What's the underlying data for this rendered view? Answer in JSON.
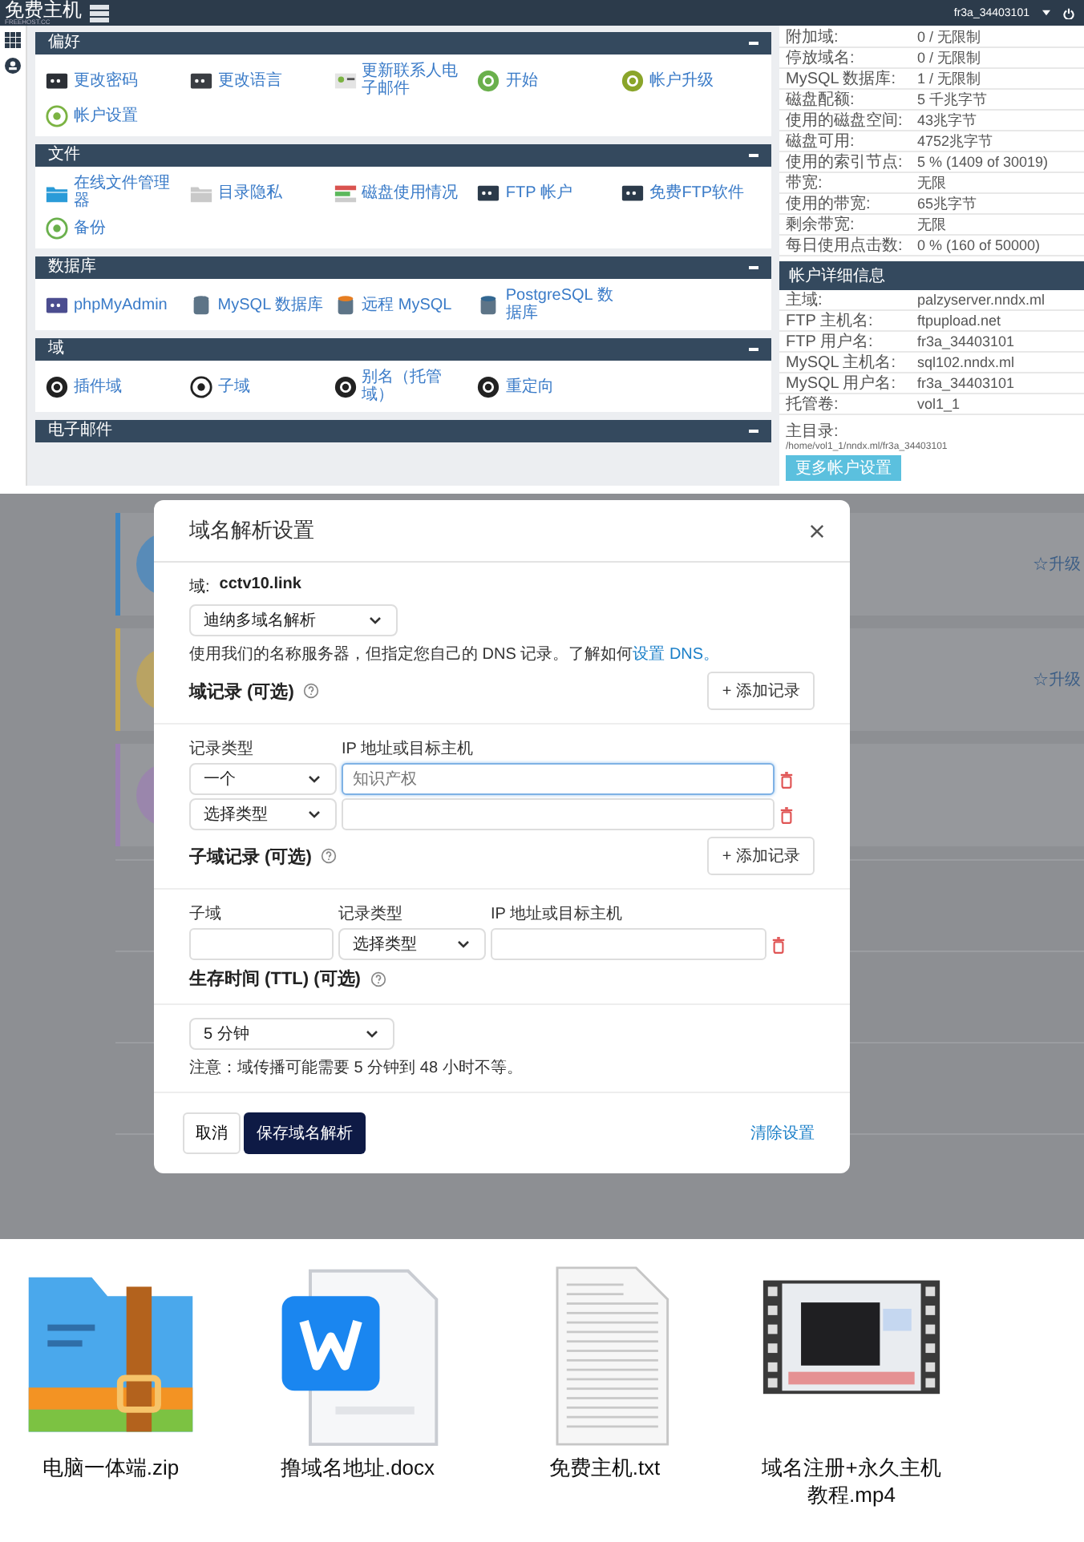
{
  "top_panel": {
    "header": {
      "logo": "免费主机",
      "logo_subtitle": "FREEHOST.CC",
      "user": "fr3a_34403101"
    },
    "sections": [
      {
        "title": "偏好",
        "items": [
          "更改密码",
          "更改语言",
          "更新联系人电子邮件",
          "开始",
          "帐户升级",
          "帐户设置"
        ]
      },
      {
        "title": "文件",
        "items": [
          "在线文件管理器",
          "目录隐私",
          "磁盘使用情况",
          "FTP 帐户",
          "免费FTP软件",
          "备份"
        ]
      },
      {
        "title": "数据库",
        "items": [
          "phpMyAdmin",
          "MySQL 数据库",
          "远程 MySQL",
          "PostgreSQL 数据库"
        ]
      },
      {
        "title": "域",
        "items": [
          "插件域",
          "子域",
          "别名（托管域）",
          "重定向"
        ]
      },
      {
        "title": "电子邮件"
      }
    ],
    "stats": [
      {
        "label": "附加域:",
        "value": "0 / 无限制"
      },
      {
        "label": "停放域名:",
        "value": "0 / 无限制"
      },
      {
        "label": "MySQL 数据库:",
        "value": "1 / 无限制"
      },
      {
        "label": "磁盘配额:",
        "value": "5 千兆字节"
      },
      {
        "label": "使用的磁盘空间:",
        "value": "43兆字节"
      },
      {
        "label": "磁盘可用:",
        "value": "4752兆字节"
      },
      {
        "label": "使用的索引节点:",
        "value": "5 % (1409 of 30019)"
      },
      {
        "label": "带宽:",
        "value": "无限"
      },
      {
        "label": "使用的带宽:",
        "value": "65兆字节"
      },
      {
        "label": "剩余带宽:",
        "value": "无限"
      },
      {
        "label": "每日使用点击数:",
        "value": "0 % (160 of 50000)"
      }
    ],
    "account_details": {
      "title": "帐户详细信息",
      "rows": [
        {
          "label": "主域:",
          "value": "palzyserver.nndx.ml"
        },
        {
          "label": "FTP 主机名:",
          "value": "ftpupload.net"
        },
        {
          "label": "FTP 用户名:",
          "value": "fr3a_34403101"
        },
        {
          "label": "MySQL 主机名:",
          "value": "sql102.nndx.ml"
        },
        {
          "label": "MySQL 用户名:",
          "value": "fr3a_34403101"
        },
        {
          "label": "托管卷:",
          "value": "vol1_1"
        }
      ],
      "home_label": "主目录:",
      "home_path": "/home/vol1_1/nndx.ml/fr3a_34403101",
      "button": "更多帐户设置"
    }
  },
  "dialog_panel": {
    "background": {
      "cards": [
        {
          "color": "#3d86c4",
          "link": "☆升级"
        },
        {
          "color": "#c8a84c",
          "link": "☆升级"
        },
        {
          "color": "#9b7fb3"
        }
      ]
    },
    "dialog": {
      "title": "域名解析设置",
      "domain_label": "域:",
      "domain": "cctv10.link",
      "mode_select": "迪纳多域名解析",
      "description": "使用我们的名称服务器，但指定您自己的 DNS 记录。了解如何",
      "description_link": "设置 DNS。",
      "domain_records": {
        "title": "域记录 (可选)",
        "add_button": "+ 添加记录",
        "columns": [
          "记录类型",
          "IP 地址或目标主机"
        ],
        "rows": [
          {
            "type": "一个",
            "placeholder": "知识产权",
            "focused": true
          },
          {
            "type": "选择类型",
            "focused": false
          }
        ]
      },
      "subdomain_records": {
        "title": "子域记录 (可选)",
        "add_button": "+ 添加记录",
        "columns": [
          "子域",
          "记录类型",
          "IP 地址或目标主机"
        ],
        "rows": [
          {
            "type": "选择类型"
          }
        ]
      },
      "ttl": {
        "title": "生存时间 (TTL) (可选)",
        "select": "5 分钟",
        "note": "注意：域传播可能需要 5 分钟到 48 小时不等。"
      },
      "cancel": "取消",
      "save": "保存域名解析",
      "clear": "清除设置"
    }
  },
  "files": [
    {
      "kind": "zip",
      "name": "电脑一体端.zip"
    },
    {
      "kind": "docx",
      "name": "撸域名地址.docx"
    },
    {
      "kind": "txt",
      "name": "免费主机.txt"
    },
    {
      "kind": "video",
      "name": "域名注册+永久主机教程.mp4"
    }
  ]
}
